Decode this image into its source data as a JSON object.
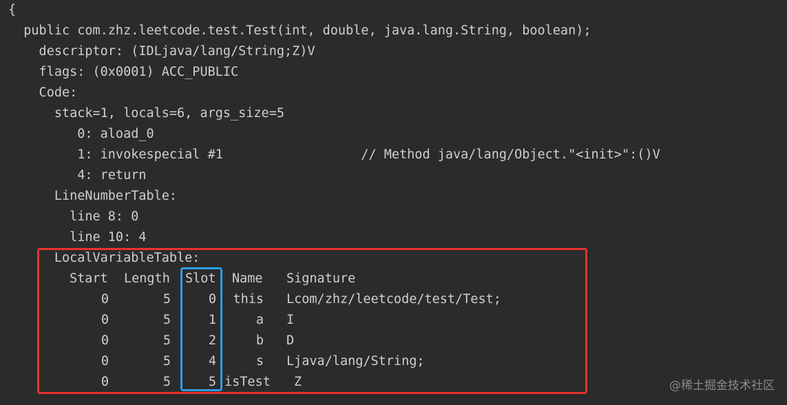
{
  "code_lines": [
    "{",
    "  public com.zhz.leetcode.test.Test(int, double, java.lang.String, boolean);",
    "    descriptor: (IDLjava/lang/String;Z)V",
    "    flags: (0x0001) ACC_PUBLIC",
    "    Code:",
    "      stack=1, locals=6, args_size=5",
    "         0: aload_0",
    "         1: invokespecial #1                  // Method java/lang/Object.\"<init>\":()V",
    "         4: return",
    "      LineNumberTable:",
    "        line 8: 0",
    "        line 10: 4",
    "      LocalVariableTable:"
  ],
  "local_variable_table": {
    "headers": [
      "Start",
      "Length",
      "Slot",
      "Name",
      "Signature"
    ],
    "rows": [
      {
        "start": "0",
        "length": "5",
        "slot": "0",
        "name": "this",
        "signature": "Lcom/zhz/leetcode/test/Test;"
      },
      {
        "start": "0",
        "length": "5",
        "slot": "1",
        "name": "a",
        "signature": "I"
      },
      {
        "start": "0",
        "length": "5",
        "slot": "2",
        "name": "b",
        "signature": "D"
      },
      {
        "start": "0",
        "length": "5",
        "slot": "4",
        "name": "s",
        "signature": "Ljava/lang/String;"
      },
      {
        "start": "0",
        "length": "5",
        "slot": "5",
        "name": "isTest",
        "signature": "Z"
      }
    ]
  },
  "highlight_colors": {
    "table_box": "#e8322d",
    "slot_column_box": "#2a9fe6"
  },
  "watermark": "@稀土掘金技术社区"
}
